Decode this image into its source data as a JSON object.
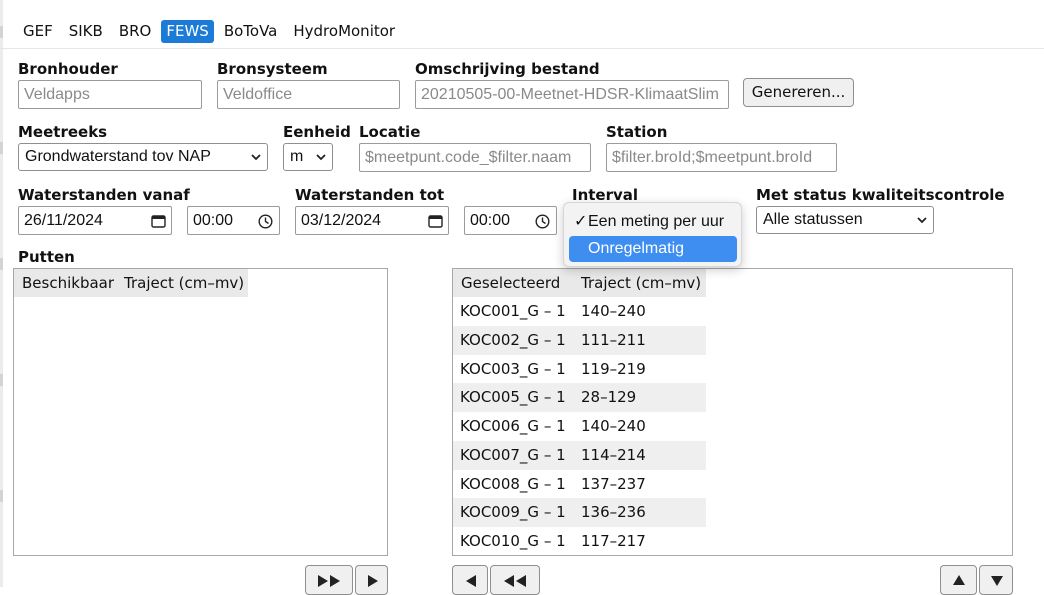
{
  "tabs": [
    {
      "label": "GEF"
    },
    {
      "label": "SIKB"
    },
    {
      "label": "BRO"
    },
    {
      "label": "FEWS",
      "active": true
    },
    {
      "label": "BoToVa"
    },
    {
      "label": "HydroMonitor"
    }
  ],
  "form": {
    "bronhouder": {
      "label": "Bronhouder",
      "placeholder": "Veldapps"
    },
    "bronsysteem": {
      "label": "Bronsysteem",
      "placeholder": "Veldoffice"
    },
    "omschrijving": {
      "label": "Omschrijving bestand",
      "value": "20210505-00-Meetnet-HDSR-KlimaatSlim"
    },
    "genereren_label": "Genereren...",
    "meetreeks": {
      "label": "Meetreeks",
      "value": "Grondwaterstand tov NAP"
    },
    "eenheid": {
      "label": "Eenheid",
      "value": "m"
    },
    "locatie": {
      "label": "Locatie",
      "placeholder": "$meetpunt.code_$filter.naam"
    },
    "station": {
      "label": "Station",
      "placeholder": "$filter.broId;$meetpunt.broId"
    },
    "vanaf": {
      "label": "Waterstanden vanaf",
      "date": "26/11/2024",
      "time": "00:00"
    },
    "tot": {
      "label": "Waterstanden tot",
      "date": "03/12/2024",
      "time": "00:00"
    },
    "interval": {
      "label": "Interval",
      "options": [
        {
          "label": "Een meting per uur",
          "checked": true
        },
        {
          "label": "Onregelmatig",
          "highlighted": true
        }
      ]
    },
    "status": {
      "label": "Met status kwaliteitscontrole",
      "value": "Alle statussen"
    }
  },
  "putten": {
    "label": "Putten",
    "available": {
      "headers": [
        "Beschikbaar",
        "Traject (cm–mv)"
      ],
      "rows": []
    },
    "selected": {
      "headers": [
        "Geselecteerd",
        "Traject (cm–mv)"
      ],
      "rows": [
        {
          "name": "KOC001_G – 1",
          "traject": "140–240"
        },
        {
          "name": "KOC002_G – 1",
          "traject": "111–211"
        },
        {
          "name": "KOC003_G – 1",
          "traject": "119–219"
        },
        {
          "name": "KOC005_G – 1",
          "traject": "28–129"
        },
        {
          "name": "KOC006_G – 1",
          "traject": "140–240"
        },
        {
          "name": "KOC007_G – 1",
          "traject": "114–214"
        },
        {
          "name": "KOC008_G – 1",
          "traject": "137–237"
        },
        {
          "name": "KOC009_G – 1",
          "traject": "136–236"
        },
        {
          "name": "KOC010_G – 1",
          "traject": "117–217"
        }
      ]
    }
  },
  "colors": {
    "accent": "#1b7bd6",
    "highlight": "#3d8ef0",
    "row_alt": "#efefef",
    "header": "#e9e9e9"
  }
}
